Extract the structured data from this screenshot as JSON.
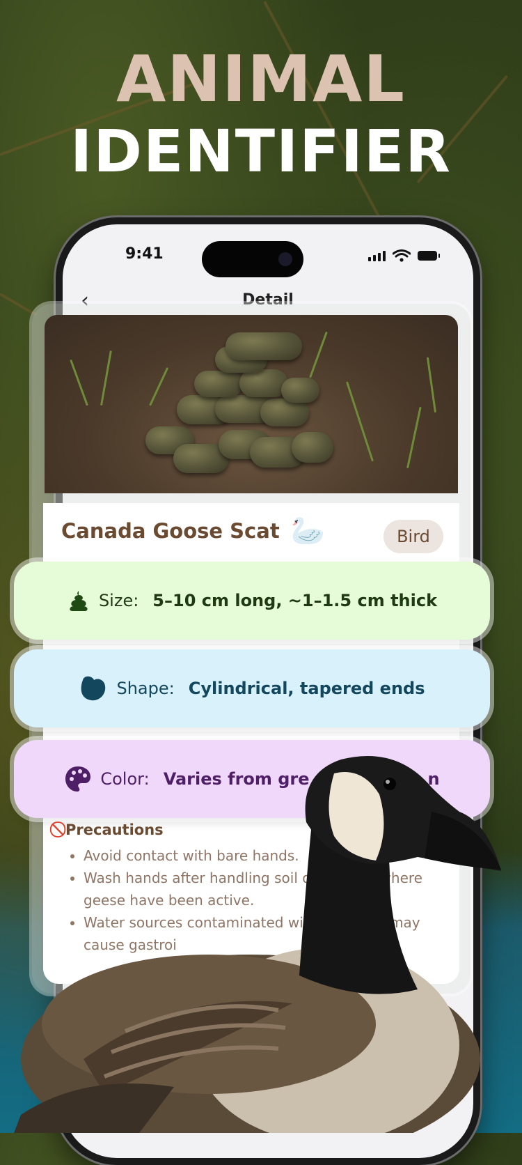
{
  "hero": {
    "line1": "ANIMAL",
    "line2": "IDENTIFIER"
  },
  "status_bar": {
    "time": "9:41"
  },
  "nav": {
    "back_icon": "chevron-left",
    "title": "Detail"
  },
  "animal": {
    "name": "Canada Goose Scat",
    "emoji": "🦢",
    "category": "Bird"
  },
  "traits": {
    "size": {
      "icon": "poop-icon",
      "label": "Size:",
      "value": "5–10 cm long, ~1–1.5 cm thick"
    },
    "shape": {
      "icon": "blob-icon",
      "label": "Shape:",
      "value": "Cylindrical, tapered ends"
    },
    "color": {
      "icon": "palette-icon",
      "label": "Color:",
      "value": "Varies from gre",
      "value_tail": "n"
    }
  },
  "precautions": {
    "icon": "prohibited-icon",
    "title": "Precautions",
    "items": [
      "Avoid contact with bare hands.",
      "Wash hands after handling soil or areas where geese have been active.",
      "Water sources contaminated with scat may cause gastrointestinal issues."
    ],
    "visible_items": [
      "Avoid contact with bare hands.",
      "Wash hands after handling soil o",
      "es where",
      "geese have been active.",
      "Water sources contaminated wit",
      "at may",
      "cause gastroi"
    ]
  },
  "colors": {
    "accent_brown": "#6b4a32",
    "size_bg": "#e6fbd8",
    "shape_bg": "#d8f1fb",
    "color_bg": "#f0d8fb"
  }
}
